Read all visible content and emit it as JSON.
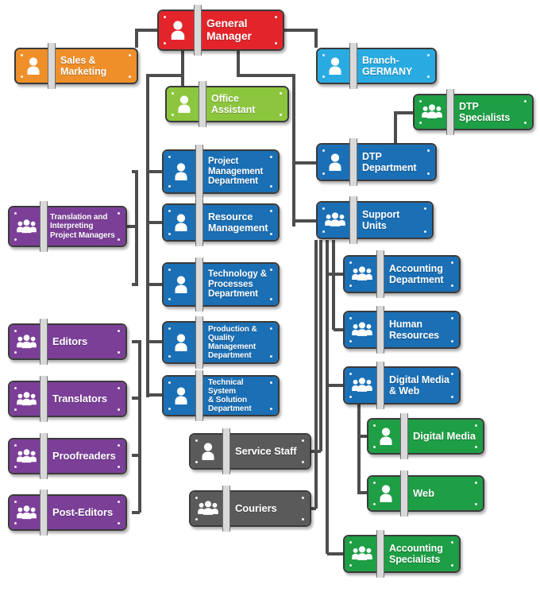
{
  "chart_data": {
    "type": "diagram",
    "title": "Organizational Chart",
    "diagram_kind": "org-chart",
    "node_count": 25,
    "color_legend": {
      "red": "#e3242b",
      "orange": "#ef8f2a",
      "light_green": "#8cc63e",
      "light_blue": "#29abe2",
      "dark_green": "#1e9e45",
      "medium_blue": "#1a6fb5",
      "purple": "#7b3f98",
      "gray": "#5a5a5a"
    },
    "edges": [
      [
        "general-manager",
        "sales-marketing"
      ],
      [
        "general-manager",
        "office-assistant"
      ],
      [
        "general-manager",
        "branch-germany"
      ],
      [
        "general-manager",
        "project-management-department"
      ],
      [
        "general-manager",
        "resource-management"
      ],
      [
        "general-manager",
        "technology-processes-department"
      ],
      [
        "general-manager",
        "production-quality-management-department"
      ],
      [
        "general-manager",
        "technical-system-solution-department"
      ],
      [
        "general-manager",
        "dtp-department"
      ],
      [
        "general-manager",
        "support-units"
      ],
      [
        "dtp-department",
        "dtp-specialists"
      ],
      [
        "project-management-department",
        "translation-interpreting-project-managers"
      ],
      [
        "resource-management",
        "translation-interpreting-project-managers"
      ],
      [
        "technology-processes-department",
        "translation-interpreting-project-managers"
      ],
      [
        "production-quality-management-department",
        "editors"
      ],
      [
        "production-quality-management-department",
        "translators"
      ],
      [
        "production-quality-management-department",
        "proofreaders"
      ],
      [
        "production-quality-management-department",
        "post-editors"
      ],
      [
        "support-units",
        "accounting-department"
      ],
      [
        "support-units",
        "human-resources"
      ],
      [
        "support-units",
        "digital-media-web"
      ],
      [
        "support-units",
        "service-staff"
      ],
      [
        "support-units",
        "couriers"
      ],
      [
        "support-units",
        "accounting-specialists"
      ],
      [
        "digital-media-web",
        "digital-media"
      ],
      [
        "digital-media-web",
        "web"
      ]
    ]
  },
  "nodes": {
    "general_manager": {
      "label": "General Manager",
      "icon": "person-icon",
      "color": "#e3242b"
    },
    "sales_marketing": {
      "label": "Sales &\nMarketing",
      "icon": "person-icon",
      "color": "#ef8f2a"
    },
    "office_assistant": {
      "label": "Office\nAssistant",
      "icon": "person-icon",
      "color": "#8cc63e"
    },
    "branch_germany": {
      "label": "Branch-\nGERMANY",
      "icon": "person-icon",
      "color": "#29abe2"
    },
    "dtp_specialists": {
      "label": "DTP\nSpecialists",
      "icon": "group-icon",
      "color": "#1e9e45"
    },
    "dtp_department": {
      "label": "DTP\nDepartment",
      "icon": "person-icon",
      "color": "#1a6fb5"
    },
    "support_units": {
      "label": "Support\nUnits",
      "icon": "group-icon",
      "color": "#1a6fb5"
    },
    "project_management_department": {
      "label": "Project\nManagement\nDepartment",
      "icon": "person-icon",
      "color": "#1a6fb5"
    },
    "resource_management": {
      "label": "Resource\nManagement",
      "icon": "person-icon",
      "color": "#1a6fb5"
    },
    "technology_processes_department": {
      "label": "Technology &\nProcesses\nDepartment",
      "icon": "person-icon",
      "color": "#1a6fb5"
    },
    "production_quality_management_department": {
      "label": "Production & Quality\nManagement\nDepartment",
      "icon": "person-icon",
      "color": "#1a6fb5"
    },
    "technical_system_solution_department": {
      "label": "Technical System\n& Solution\nDepartment",
      "icon": "person-icon",
      "color": "#1a6fb5"
    },
    "translation_interpreting_project_managers": {
      "label": "Translation and\nInterpreting\nProject Managers",
      "icon": "group-icon",
      "color": "#7b3f98"
    },
    "editors": {
      "label": "Editors",
      "icon": "group-icon",
      "color": "#7b3f98"
    },
    "translators": {
      "label": "Translators",
      "icon": "group-icon",
      "color": "#7b3f98"
    },
    "proofreaders": {
      "label": "Proofreaders",
      "icon": "group-icon",
      "color": "#7b3f98"
    },
    "post_editors": {
      "label": "Post-Editors",
      "icon": "group-icon",
      "color": "#7b3f98"
    },
    "service_staff": {
      "label": "Service Staff",
      "icon": "person-icon",
      "color": "#5a5a5a"
    },
    "couriers": {
      "label": "Couriers",
      "icon": "group-icon",
      "color": "#5a5a5a"
    },
    "accounting_department": {
      "label": "Accounting\nDepartment",
      "icon": "group-icon",
      "color": "#1a6fb5"
    },
    "human_resources": {
      "label": "Human\nResources",
      "icon": "group-icon",
      "color": "#1a6fb5"
    },
    "digital_media_web": {
      "label": "Digital Media\n& Web",
      "icon": "group-icon",
      "color": "#1a6fb5"
    },
    "digital_media": {
      "label": "Digital Media",
      "icon": "person-icon",
      "color": "#1e9e45"
    },
    "web": {
      "label": "Web",
      "icon": "person-icon",
      "color": "#1e9e45"
    },
    "accounting_specialists": {
      "label": "Accounting\nSpecialists",
      "icon": "group-icon",
      "color": "#1e9e45"
    }
  }
}
